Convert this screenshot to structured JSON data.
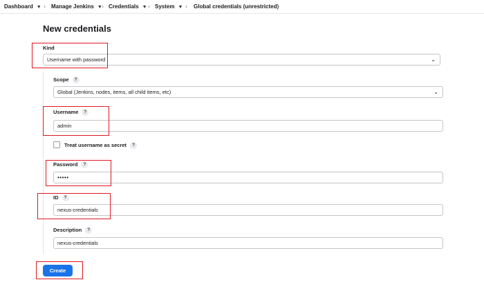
{
  "breadcrumb": {
    "items": [
      {
        "label": "Dashboard"
      },
      {
        "label": "Manage Jenkins"
      },
      {
        "label": "Credentials"
      },
      {
        "label": "System"
      },
      {
        "label": "Global credentials (unrestricted)"
      }
    ],
    "separator": "›"
  },
  "page": {
    "title": "New credentials"
  },
  "form": {
    "kind": {
      "label": "Kind",
      "value": "Username with password"
    },
    "scope": {
      "label": "Scope",
      "help": "?",
      "value": "Global (Jenkins, nodes, items, all child items, etc)"
    },
    "username": {
      "label": "Username",
      "help": "?",
      "value": "admin"
    },
    "treat_secret": {
      "label": "Treat username as secret",
      "help": "?",
      "checked": false
    },
    "password": {
      "label": "Password",
      "help": "?",
      "value": "•••••"
    },
    "id": {
      "label": "ID",
      "help": "?",
      "value": "nexus-credentials"
    },
    "description": {
      "label": "Description",
      "help": "?",
      "value": "nexus-credentials"
    },
    "create_label": "Create"
  },
  "annotation_color": "#e0161e",
  "accent_color": "#1a73e8"
}
